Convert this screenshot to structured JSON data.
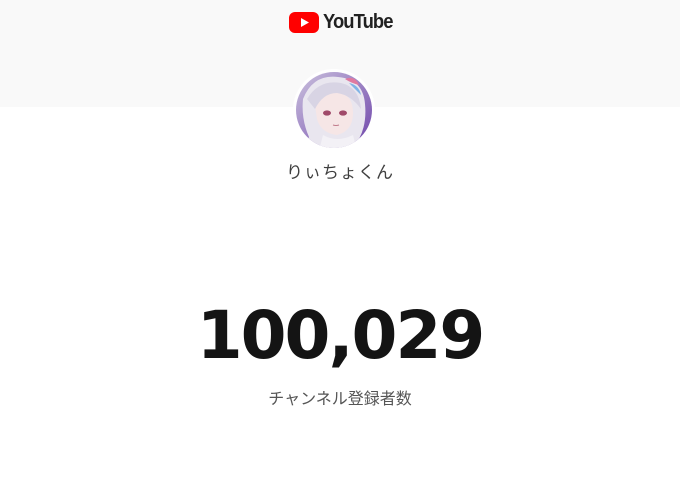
{
  "brand": {
    "name": "YouTube",
    "icon": "youtube-logo-icon",
    "color": "#ff0000"
  },
  "channel": {
    "name": "りぃちょくん",
    "avatar": "channel-avatar"
  },
  "stats": {
    "subscriber_count": "100,029",
    "subscriber_label": "チャンネル登録者数"
  },
  "colors": {
    "header_background": "#f9f9f9",
    "count_text": "#141414",
    "label_text": "#555555"
  }
}
